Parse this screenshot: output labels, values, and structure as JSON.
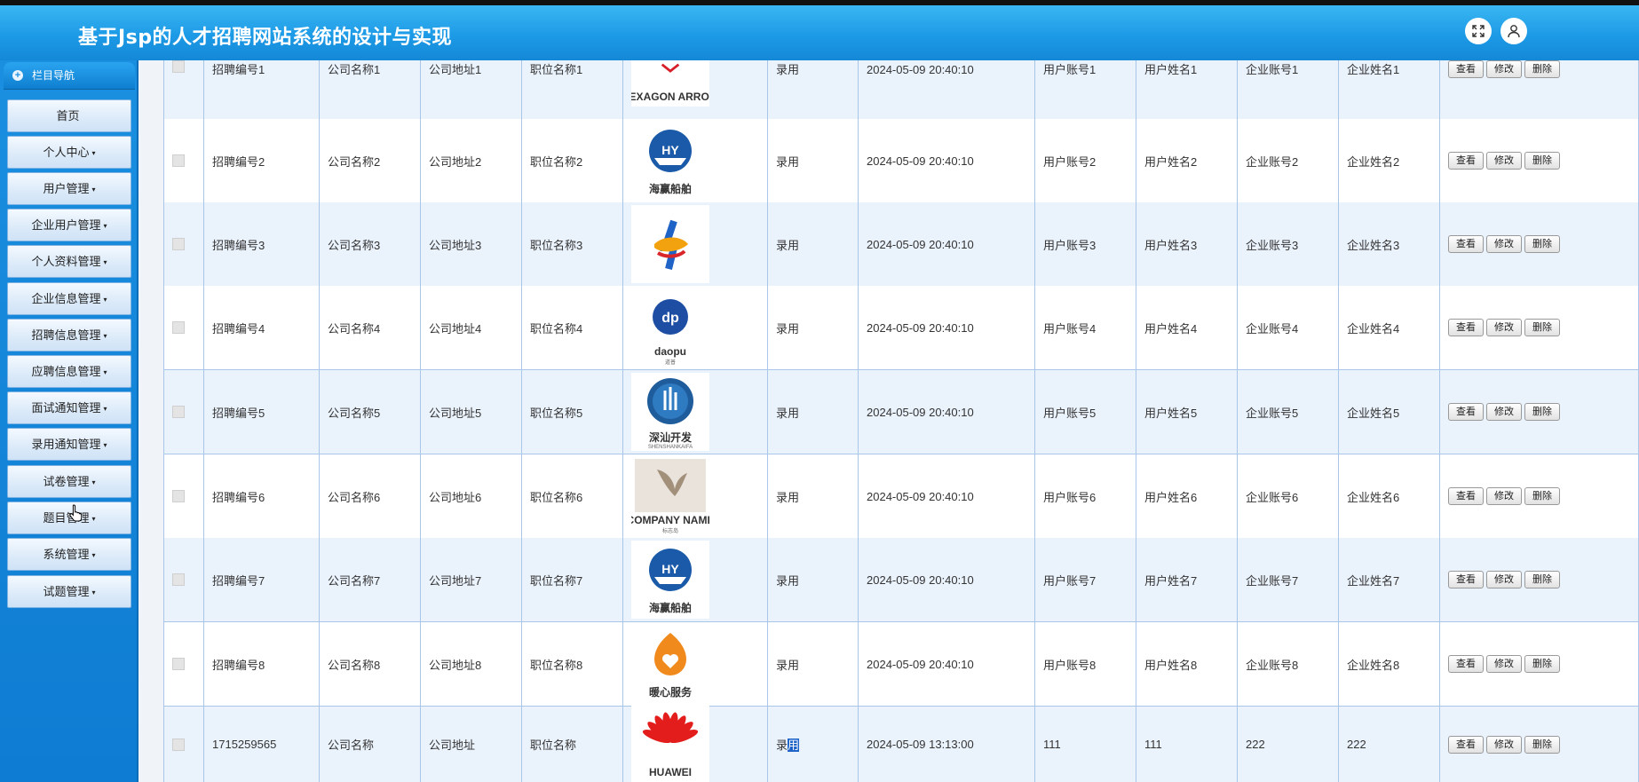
{
  "app": {
    "title": "基于Jsp的人才招聘网站系统的设计与实现"
  },
  "header_icons": [
    "fullscreen-icon",
    "user-icon"
  ],
  "sidebar": {
    "heading": "栏目导航",
    "items": [
      {
        "label": "首页",
        "caret": ""
      },
      {
        "label": "个人中心",
        "caret": "▾"
      },
      {
        "label": "用户管理",
        "caret": "▾"
      },
      {
        "label": "企业用户管理",
        "caret": "▾"
      },
      {
        "label": "个人资料管理",
        "caret": "▾"
      },
      {
        "label": "企业信息管理",
        "caret": "▾"
      },
      {
        "label": "招聘信息管理",
        "caret": "▾"
      },
      {
        "label": "应聘信息管理",
        "caret": "▾"
      },
      {
        "label": "面试通知管理",
        "caret": "▾"
      },
      {
        "label": "录用通知管理",
        "caret": "▾"
      },
      {
        "label": "试卷管理",
        "caret": "▾"
      },
      {
        "label": "题目管理",
        "caret": "▾"
      },
      {
        "label": "系统管理",
        "caret": "▾"
      },
      {
        "label": "试题管理",
        "caret": "▾"
      }
    ]
  },
  "actions": {
    "view": "查看",
    "edit": "修改",
    "delete": "删除"
  },
  "colors": {
    "header": "#1d9ae6",
    "sidebar": "#0e7cd2",
    "row_alt": "#eaf2fc",
    "highlight": "#1e64c8"
  },
  "table": {
    "rows": [
      {
        "no": "招聘编号1",
        "company": "公司名称1",
        "address": "公司地址1",
        "position": "职位名称1",
        "logo": "HEXAGON ARROW",
        "logo_sub": "",
        "status": "录用",
        "time": "2024-05-09 20:40:10",
        "user_acct": "用户账号1",
        "user_name": "用户姓名1",
        "corp_acct": "企业账号1",
        "corp_name": "企业姓名1"
      },
      {
        "no": "招聘编号2",
        "company": "公司名称2",
        "address": "公司地址2",
        "position": "职位名称2",
        "logo": "海赢船舶",
        "logo_sub": "",
        "status": "录用",
        "time": "2024-05-09 20:40:10",
        "user_acct": "用户账号2",
        "user_name": "用户姓名2",
        "corp_acct": "企业账号2",
        "corp_name": "企业姓名2"
      },
      {
        "no": "招聘编号3",
        "company": "公司名称3",
        "address": "公司地址3",
        "position": "职位名称3",
        "logo": "",
        "logo_sub": "",
        "status": "录用",
        "time": "2024-05-09 20:40:10",
        "user_acct": "用户账号3",
        "user_name": "用户姓名3",
        "corp_acct": "企业账号3",
        "corp_name": "企业姓名3"
      },
      {
        "no": "招聘编号4",
        "company": "公司名称4",
        "address": "公司地址4",
        "position": "职位名称4",
        "logo": "daopu",
        "logo_sub": "道普",
        "status": "录用",
        "time": "2024-05-09 20:40:10",
        "user_acct": "用户账号4",
        "user_name": "用户姓名4",
        "corp_acct": "企业账号4",
        "corp_name": "企业姓名4"
      },
      {
        "no": "招聘编号5",
        "company": "公司名称5",
        "address": "公司地址5",
        "position": "职位名称5",
        "logo": "深汕开发",
        "logo_sub": "SHENSHANKAIFA",
        "status": "录用",
        "time": "2024-05-09 20:40:10",
        "user_acct": "用户账号5",
        "user_name": "用户姓名5",
        "corp_acct": "企业账号5",
        "corp_name": "企业姓名5"
      },
      {
        "no": "招聘编号6",
        "company": "公司名称6",
        "address": "公司地址6",
        "position": "职位名称6",
        "logo": "COMPANY NAME",
        "logo_sub": "标志岛",
        "status": "录用",
        "time": "2024-05-09 20:40:10",
        "user_acct": "用户账号6",
        "user_name": "用户姓名6",
        "corp_acct": "企业账号6",
        "corp_name": "企业姓名6"
      },
      {
        "no": "招聘编号7",
        "company": "公司名称7",
        "address": "公司地址7",
        "position": "职位名称7",
        "logo": "海赢船舶",
        "logo_sub": "",
        "status": "录用",
        "time": "2024-05-09 20:40:10",
        "user_acct": "用户账号7",
        "user_name": "用户姓名7",
        "corp_acct": "企业账号7",
        "corp_name": "企业姓名7"
      },
      {
        "no": "招聘编号8",
        "company": "公司名称8",
        "address": "公司地址8",
        "position": "职位名称8",
        "logo": "暖心服务",
        "logo_sub": "",
        "status": "录用",
        "time": "2024-05-09 20:40:10",
        "user_acct": "用户账号8",
        "user_name": "用户姓名8",
        "corp_acct": "企业账号8",
        "corp_name": "企业姓名8"
      },
      {
        "no": "1715259565",
        "company": "公司名称",
        "address": "公司地址",
        "position": "职位名称",
        "logo": "HUAWEI",
        "logo_sub": "",
        "status": "录用",
        "time": "2024-05-09 13:13:00",
        "user_acct": "111",
        "user_name": "111",
        "corp_acct": "222",
        "corp_name": "222"
      }
    ]
  }
}
